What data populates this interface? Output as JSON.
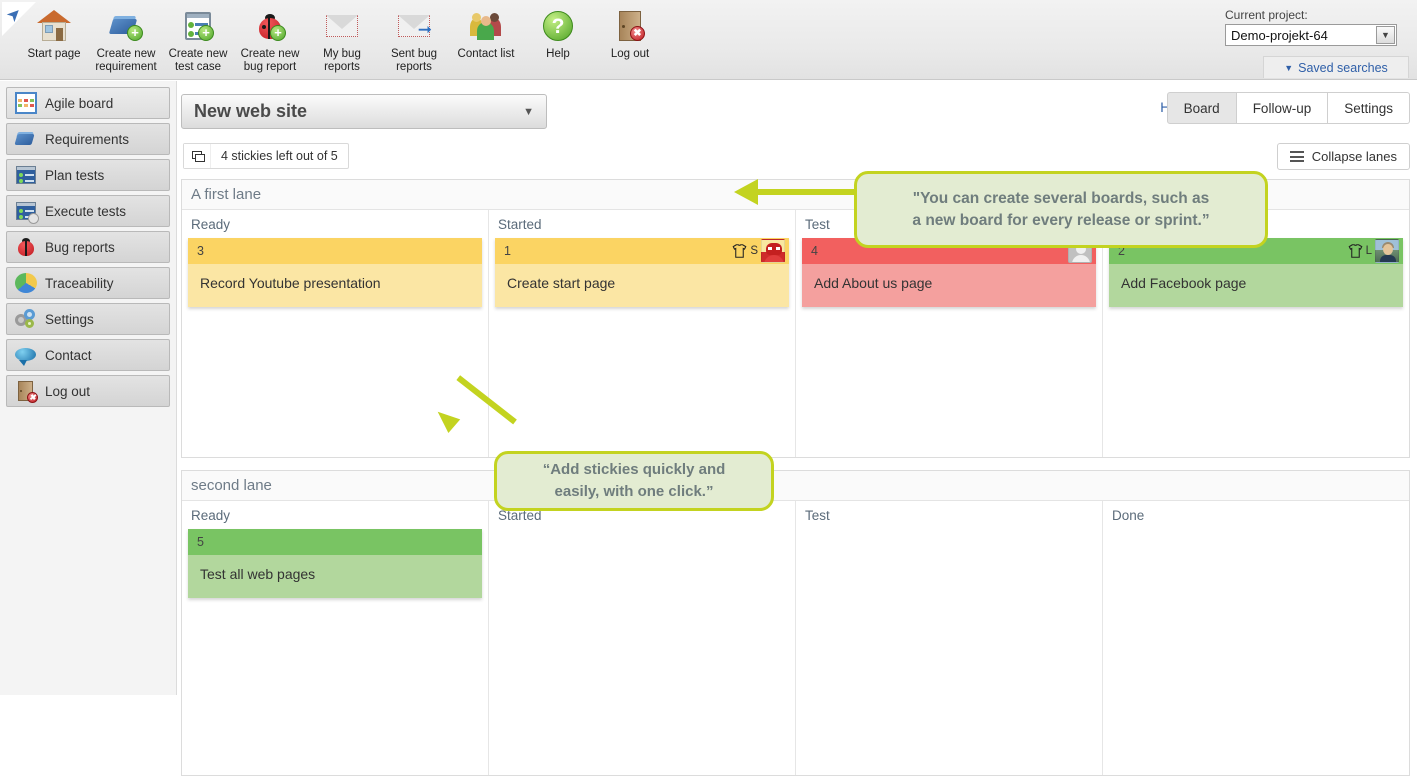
{
  "toolbar": {
    "items": [
      {
        "label": "Start page",
        "icon": "house-icon"
      },
      {
        "label": "Create new requirement",
        "icon": "new-requirement-icon"
      },
      {
        "label": "Create new test case",
        "icon": "new-test-case-icon"
      },
      {
        "label": "Create new bug report",
        "icon": "new-bug-report-icon"
      },
      {
        "label": "My bug reports",
        "icon": "envelope-icon"
      },
      {
        "label": "Sent bug reports",
        "icon": "envelope-sent-icon"
      },
      {
        "label": "Contact list",
        "icon": "people-icon"
      },
      {
        "label": "Help",
        "icon": "help-question-icon"
      },
      {
        "label": "Log out",
        "icon": "door-logout-icon"
      }
    ],
    "project_label": "Current project:",
    "project_value": "Demo-projekt-64",
    "saved_searches": "Saved searches"
  },
  "sidebar": {
    "items": [
      {
        "label": "Agile board",
        "icon": "agile-board-icon",
        "active": true
      },
      {
        "label": "Requirements",
        "icon": "requirements-icon",
        "active": false
      },
      {
        "label": "Plan tests",
        "icon": "plan-tests-icon",
        "active": false
      },
      {
        "label": "Execute tests",
        "icon": "execute-tests-icon",
        "active": false
      },
      {
        "label": "Bug reports",
        "icon": "bug-reports-icon",
        "active": false
      },
      {
        "label": "Traceability",
        "icon": "traceability-pie-icon",
        "active": false
      },
      {
        "label": "Settings",
        "icon": "settings-gears-icon",
        "active": false
      },
      {
        "label": "Contact",
        "icon": "contact-chat-icon",
        "active": false
      },
      {
        "label": "Log out",
        "icon": "logout-door-icon",
        "active": false
      }
    ]
  },
  "board": {
    "selected_board": "New web site",
    "stickies_status": "4 stickies left out of 5",
    "help_link": "Help",
    "tabs": [
      {
        "label": "Board",
        "active": true
      },
      {
        "label": "Follow-up",
        "active": false
      },
      {
        "label": "Settings",
        "active": false
      }
    ],
    "collapse_lanes": "Collapse lanes",
    "columns": [
      "Ready",
      "Started",
      "Test",
      "Done"
    ],
    "lanes": [
      {
        "title": "A first lane",
        "columns": [
          {
            "name": "Ready",
            "cards": [
              {
                "id": "3",
                "title": "Record Youtube presentation",
                "color": "yellow",
                "size": null,
                "avatar": null
              }
            ]
          },
          {
            "name": "Started",
            "cards": [
              {
                "id": "1",
                "title": "Create start page",
                "color": "yellow",
                "size": "S",
                "avatar": "wrestler"
              }
            ]
          },
          {
            "name": "Test",
            "cards": [
              {
                "id": "4",
                "title": "Add About us page",
                "color": "red",
                "size": null,
                "avatar": "blank"
              }
            ]
          },
          {
            "name": "Done",
            "cards": [
              {
                "id": "2",
                "title": "Add Facebook page",
                "color": "green",
                "size": "L",
                "avatar": "photo"
              }
            ]
          }
        ]
      },
      {
        "title": "second lane",
        "columns": [
          {
            "name": "Ready",
            "cards": [
              {
                "id": "5",
                "title": "Test all web pages",
                "color": "green",
                "size": null,
                "avatar": null
              }
            ]
          },
          {
            "name": "Started",
            "cards": []
          },
          {
            "name": "Test",
            "cards": []
          },
          {
            "name": "Done",
            "cards": []
          }
        ]
      }
    ]
  },
  "callouts": [
    {
      "line1": "\"You can create several boards, such as",
      "line2": "a new board for every release or sprint.”"
    },
    {
      "line1": "“Add stickies quickly and",
      "line2": "easily, with one click.”"
    }
  ],
  "colors": {
    "callout_border": "#c3d320",
    "callout_fill": "#e3ecd2",
    "sticky_yellow_head": "#fbd463",
    "sticky_yellow_body": "#fbe6a4",
    "sticky_red_head": "#f2605f",
    "sticky_red_body": "#f4a09e",
    "sticky_green_head": "#79c463",
    "sticky_green_body": "#b2d79d",
    "link_blue": "#2f5fa8"
  }
}
